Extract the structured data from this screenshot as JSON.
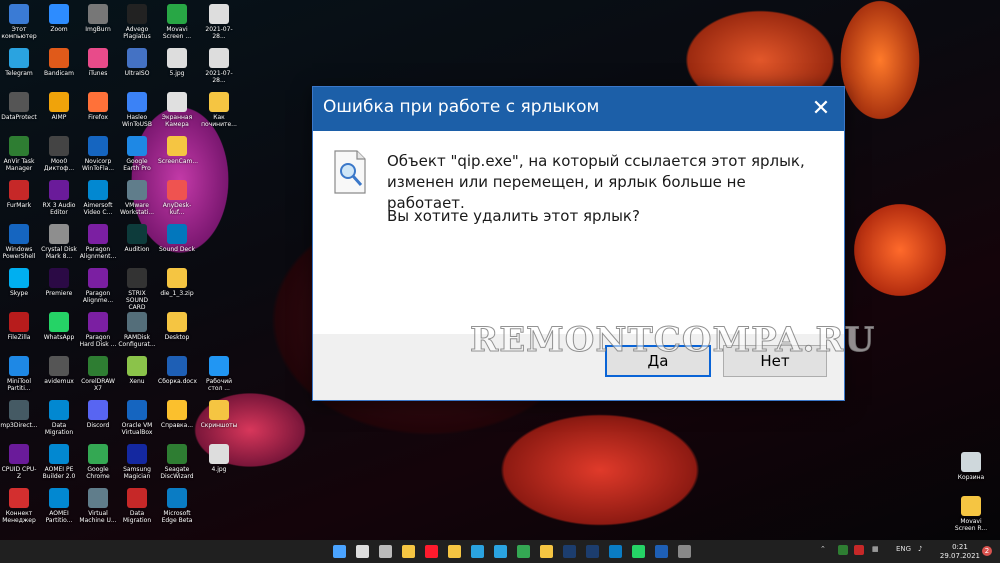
{
  "dialog": {
    "title": "Ошибка при работе с ярлыком",
    "message_line1": "Объект \"qip.exe\", на который ссылается этот ярлык,",
    "message_line2": "изменен или перемещен, и ярлык больше не работает.",
    "question": "Вы хотите удалить этот ярлык?",
    "yes_label": "Да",
    "no_label": "Нет",
    "close_symbol": "✕"
  },
  "watermark": "REMONTCOMPA.RU",
  "desktop_icons": [
    {
      "label": "Этот компьютер",
      "color": "#3a7bd5"
    },
    {
      "label": "Zoom",
      "color": "#2d8cff"
    },
    {
      "label": "ImgBurn",
      "color": "#777777"
    },
    {
      "label": "Advego Plagiatus",
      "color": "#222222"
    },
    {
      "label": "Movavi Screen ...",
      "color": "#28a745"
    },
    {
      "label": "2021-07-28...",
      "color": "#dddddd"
    },
    {
      "label": "Telegram",
      "color": "#2aa3e0"
    },
    {
      "label": "Bandicam",
      "color": "#e05a1a"
    },
    {
      "label": "iTunes",
      "color": "#e84b8a"
    },
    {
      "label": "UltraISO",
      "color": "#4472c4"
    },
    {
      "label": "5.jpg",
      "color": "#dddddd"
    },
    {
      "label": "2021-07-28...",
      "color": "#dddddd"
    },
    {
      "label": "DataProtect",
      "color": "#555555"
    },
    {
      "label": "AIMP",
      "color": "#f0a30a"
    },
    {
      "label": "Firefox",
      "color": "#ff7139"
    },
    {
      "label": "Hasleo WinToUSB",
      "color": "#3b82f6"
    },
    {
      "label": "Экранная Камера",
      "color": "#e0e0e0"
    },
    {
      "label": "Как почините...",
      "color": "#f5c542"
    },
    {
      "label": "AnVir Task Manager",
      "color": "#2e7d32"
    },
    {
      "label": "Moo0 Диктоф...",
      "color": "#444444"
    },
    {
      "label": "Novicorp WinToFla...",
      "color": "#1565c0"
    },
    {
      "label": "Google Earth Pro",
      "color": "#1e88e5"
    },
    {
      "label": "ScreenCam...",
      "color": "#f5c542"
    },
    {
      "label": "",
      "color": "transparent"
    },
    {
      "label": "FurMark",
      "color": "#c62828"
    },
    {
      "label": "RX 3 Audio Editor",
      "color": "#6a1b9a"
    },
    {
      "label": "Aimersoft Video C...",
      "color": "#0288d1"
    },
    {
      "label": "VMware Workstati...",
      "color": "#607d8b"
    },
    {
      "label": "AnyDesk-kuf...",
      "color": "#ef5350"
    },
    {
      "label": "",
      "color": "transparent"
    },
    {
      "label": "Windows PowerShell",
      "color": "#1565c0"
    },
    {
      "label": "Crystal Disk Mark 8...",
      "color": "#8e8e8e"
    },
    {
      "label": "Paragon Alignment...",
      "color": "#7b1fa2"
    },
    {
      "label": "Audition",
      "color": "#0d3b3b"
    },
    {
      "label": "Sound Deck",
      "color": "#0277bd"
    },
    {
      "label": "",
      "color": "transparent"
    },
    {
      "label": "Skype",
      "color": "#00aff0"
    },
    {
      "label": "Premiere",
      "color": "#2b0a45"
    },
    {
      "label": "Paragon Alignme...",
      "color": "#7b1fa2"
    },
    {
      "label": "STRIX SOUND CARD",
      "color": "#333333"
    },
    {
      "label": "die_1_3.zip",
      "color": "#f5c542"
    },
    {
      "label": "",
      "color": "transparent"
    },
    {
      "label": "FileZilla",
      "color": "#b71c1c"
    },
    {
      "label": "WhatsApp",
      "color": "#25d366"
    },
    {
      "label": "Paragon Hard Disk ...",
      "color": "#7b1fa2"
    },
    {
      "label": "RAMDisk Configurat...",
      "color": "#546e7a"
    },
    {
      "label": "Desktop",
      "color": "#f5c542"
    },
    {
      "label": "",
      "color": "transparent"
    },
    {
      "label": "MiniTool Partiti...",
      "color": "#1e88e5"
    },
    {
      "label": "avidemux",
      "color": "#555555"
    },
    {
      "label": "CorelDRAW X7",
      "color": "#2e7d32"
    },
    {
      "label": "Xenu",
      "color": "#8bc34a"
    },
    {
      "label": "Сборка.docx",
      "color": "#1e5fb5"
    },
    {
      "label": "Рабочий стол ...",
      "color": "#2196f3"
    },
    {
      "label": "mp3Direct...",
      "color": "#455a64"
    },
    {
      "label": "Data Migration",
      "color": "#0288d1"
    },
    {
      "label": "Discord",
      "color": "#5865f2"
    },
    {
      "label": "Oracle VM VirtualBox",
      "color": "#1565c0"
    },
    {
      "label": "Справка...",
      "color": "#fbc02d"
    },
    {
      "label": "Скриншоты",
      "color": "#f5c542"
    },
    {
      "label": "CPUID CPU-Z",
      "color": "#6a1b9a"
    },
    {
      "label": "AOMEI PE Builder 2.0",
      "color": "#0288d1"
    },
    {
      "label": "Google Chrome",
      "color": "#34a853"
    },
    {
      "label": "Samsung Magician",
      "color": "#1428a0"
    },
    {
      "label": "Seagate DiscWizard",
      "color": "#2e7d32"
    },
    {
      "label": "4.jpg",
      "color": "#dddddd"
    },
    {
      "label": "Коннект Менеджер",
      "color": "#d32f2f"
    },
    {
      "label": "AOMEI Partitio...",
      "color": "#0288d1"
    },
    {
      "label": "Virtual Machine U...",
      "color": "#607d8b"
    },
    {
      "label": "Data Migration",
      "color": "#c62828"
    },
    {
      "label": "Microsoft Edge Beta",
      "color": "#0a7cc4"
    },
    {
      "label": "",
      "color": "transparent"
    }
  ],
  "right_icons": [
    {
      "label": "Корзина",
      "color": "#cfd8dc"
    },
    {
      "label": "Movavi Screen R...",
      "color": "#f5c542"
    }
  ],
  "taskbar": {
    "icons": [
      "windows-icon",
      "search-icon",
      "taskview-icon",
      "explorer-icon",
      "opera-icon",
      "folder-icon",
      "notepad-icon",
      "telegram-icon",
      "chrome-icon",
      "files-icon",
      "photoshop-icon",
      "ps-icon",
      "edge-icon",
      "whatsapp-icon",
      "word-icon",
      "settings-icon"
    ],
    "lang": "ENG",
    "time": "0:21",
    "date": "29.07.2021",
    "notification_count": "2"
  }
}
